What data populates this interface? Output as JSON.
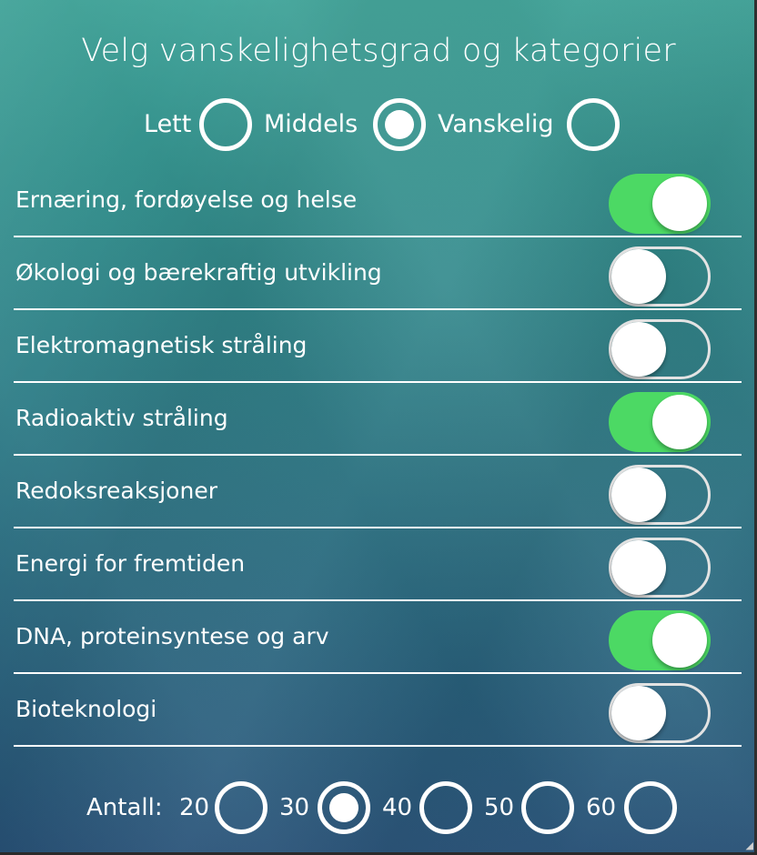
{
  "title": "Velg vanskelighetsgrad og kategorier",
  "difficulty": {
    "options": [
      {
        "label": "Lett",
        "selected": false
      },
      {
        "label": "Middels",
        "selected": true
      },
      {
        "label": "Vanskelig",
        "selected": false
      }
    ]
  },
  "categories": [
    {
      "label": "Ernæring, fordøyelse og helse",
      "enabled": true
    },
    {
      "label": "Økologi og bærekraftig utvikling",
      "enabled": false
    },
    {
      "label": "Elektromagnetisk stråling",
      "enabled": false
    },
    {
      "label": "Radioaktiv stråling",
      "enabled": true
    },
    {
      "label": "Redoksreaksjoner",
      "enabled": false
    },
    {
      "label": "Energi for fremtiden",
      "enabled": false
    },
    {
      "label": "DNA, proteinsyntese og arv",
      "enabled": true
    },
    {
      "label": "Bioteknologi",
      "enabled": false
    }
  ],
  "count": {
    "label": "Antall:",
    "options": [
      {
        "label": "20",
        "selected": false
      },
      {
        "label": "30",
        "selected": true
      },
      {
        "label": "40",
        "selected": false
      },
      {
        "label": "50",
        "selected": false
      },
      {
        "label": "60",
        "selected": false
      }
    ]
  },
  "colors": {
    "toggle_on": "#4cd964",
    "background_top": "#41a79c",
    "background_bottom": "#28537a"
  }
}
